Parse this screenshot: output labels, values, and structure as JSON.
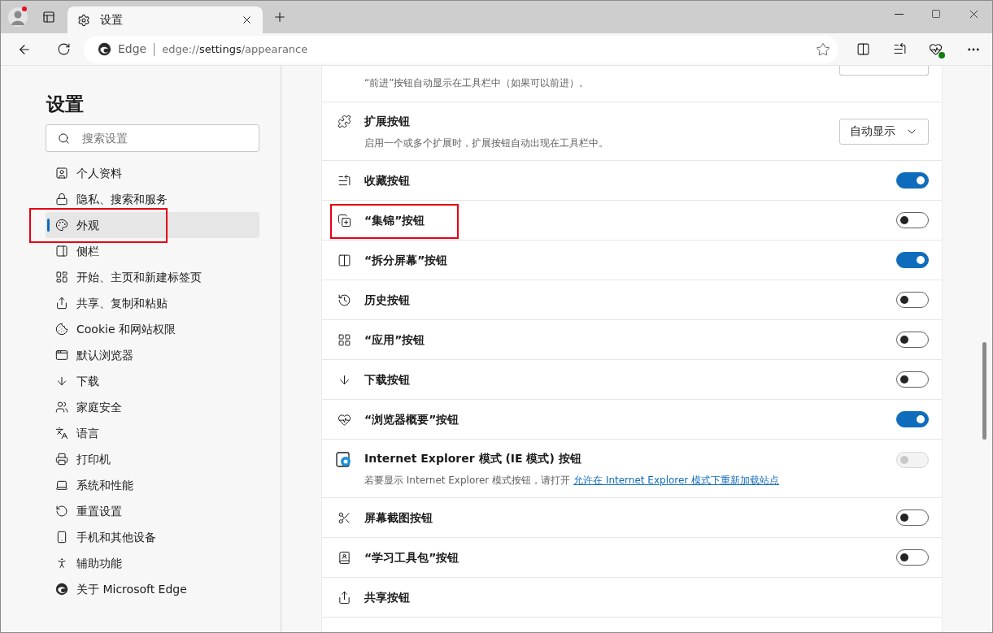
{
  "tab": {
    "title": "设置",
    "selected": true
  },
  "address_bar": {
    "site_label": "Edge",
    "url": {
      "scheme": "edge://",
      "host": "settings",
      "path": "/appearance"
    }
  },
  "sidebar": {
    "title": "设置",
    "search": {
      "placeholder": "搜索设置"
    },
    "items": [
      {
        "label": "个人资料",
        "selected": false,
        "highlighted": false
      },
      {
        "label": "隐私、搜索和服务",
        "selected": false,
        "highlighted": false
      },
      {
        "label": "外观",
        "selected": true,
        "highlighted": true
      },
      {
        "label": "侧栏",
        "selected": false,
        "highlighted": false
      },
      {
        "label": "开始、主页和新建标签页",
        "selected": false,
        "highlighted": false
      },
      {
        "label": "共享、复制和粘贴",
        "selected": false,
        "highlighted": false
      },
      {
        "label": "Cookie 和网站权限",
        "selected": false,
        "highlighted": false
      },
      {
        "label": "默认浏览器",
        "selected": false,
        "highlighted": false
      },
      {
        "label": "下载",
        "selected": false,
        "highlighted": false
      },
      {
        "label": "家庭安全",
        "selected": false,
        "highlighted": false
      },
      {
        "label": "语言",
        "selected": false,
        "highlighted": false
      },
      {
        "label": "打印机",
        "selected": false,
        "highlighted": false
      },
      {
        "label": "系统和性能",
        "selected": false,
        "highlighted": false
      },
      {
        "label": "重置设置",
        "selected": false,
        "highlighted": false
      },
      {
        "label": "手机和其他设备",
        "selected": false,
        "highlighted": false
      },
      {
        "label": "辅助功能",
        "selected": false,
        "highlighted": false
      },
      {
        "label": "关于 Microsoft Edge",
        "selected": false,
        "highlighted": false
      }
    ]
  },
  "settings": [
    {
      "kind": "dropdown_cut",
      "description": "“前进”按钮自动显示在工具栏中（如果可以前进）。",
      "highlighted": false
    },
    {
      "kind": "dropdown",
      "title": "扩展按钮",
      "description": "启用一个或多个扩展时，扩展按钮自动出现在工具栏中。",
      "value": "自动显示",
      "highlighted": false
    },
    {
      "kind": "toggle",
      "title": "收藏按钮",
      "on": true,
      "disabled": false,
      "highlighted": false
    },
    {
      "kind": "toggle",
      "title": "“集锦”按钮",
      "on": false,
      "disabled": false,
      "highlighted": true
    },
    {
      "kind": "toggle",
      "title": "“拆分屏幕”按钮",
      "on": true,
      "disabled": false,
      "highlighted": false
    },
    {
      "kind": "toggle",
      "title": "历史按钮",
      "on": false,
      "disabled": false,
      "highlighted": false
    },
    {
      "kind": "toggle",
      "title": "“应用”按钮",
      "on": false,
      "disabled": false,
      "highlighted": false
    },
    {
      "kind": "toggle",
      "title": "下载按钮",
      "on": false,
      "disabled": false,
      "highlighted": false
    },
    {
      "kind": "toggle",
      "title": "“浏览器概要”按钮",
      "on": true,
      "disabled": false,
      "highlighted": false
    },
    {
      "kind": "toggle",
      "title": "Internet Explorer 模式 (IE 模式) 按钮",
      "description": "若要显示 Internet Explorer 模式按钮，请打开",
      "link": "允许在 Internet Explorer 模式下重新加载站点",
      "on": false,
      "disabled": true,
      "highlighted": false
    },
    {
      "kind": "toggle",
      "title": "屏幕截图按钮",
      "on": false,
      "disabled": false,
      "highlighted": false
    },
    {
      "kind": "toggle",
      "title": "“学习工具包”按钮",
      "on": false,
      "disabled": false,
      "highlighted": false
    },
    {
      "kind": "plain",
      "title": "共享按钮",
      "highlighted": false
    }
  ]
}
